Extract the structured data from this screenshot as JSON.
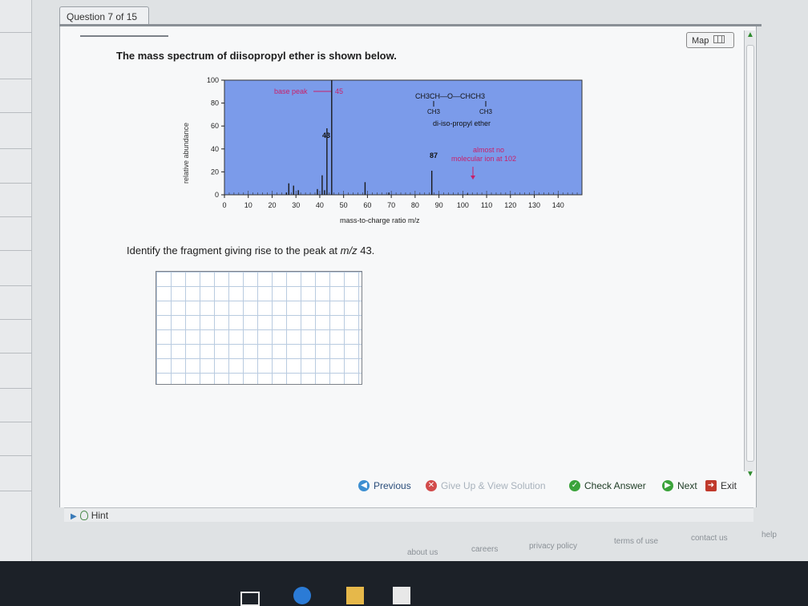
{
  "tab": {
    "title": "Question 7 of 15"
  },
  "map_button": {
    "label": "Map",
    "icon": "grid-icon"
  },
  "question": {
    "text": "The mass spectrum of diisopropyl ether is shown below."
  },
  "chart_data": {
    "type": "bar",
    "xlabel": "mass-to-charge ratio m/z",
    "ylabel": "relative abundance",
    "xlim": [
      0,
      150
    ],
    "ylim": [
      0,
      100
    ],
    "xticks": [
      0,
      10,
      20,
      30,
      40,
      50,
      60,
      70,
      80,
      90,
      100,
      110,
      120,
      130,
      140
    ],
    "yticks": [
      0,
      20,
      40,
      60,
      80,
      100
    ],
    "peaks": [
      {
        "mz": 26,
        "value": 2
      },
      {
        "mz": 27,
        "value": 10
      },
      {
        "mz": 29,
        "value": 8
      },
      {
        "mz": 31,
        "value": 4
      },
      {
        "mz": 39,
        "value": 5
      },
      {
        "mz": 41,
        "value": 17
      },
      {
        "mz": 42,
        "value": 4
      },
      {
        "mz": 43,
        "value": 58
      },
      {
        "mz": 45,
        "value": 100
      },
      {
        "mz": 59,
        "value": 11
      },
      {
        "mz": 69,
        "value": 2
      },
      {
        "mz": 87,
        "value": 21
      },
      {
        "mz": 102,
        "value": 1
      }
    ],
    "annotations": {
      "base_peak": "base peak",
      "base_peak_mz": "45",
      "peak_43": "43",
      "peak_87": "87",
      "almost_no_line1": "almost no",
      "almost_no_line2": "molecular ion at 102",
      "structure_line1": "CH3CH—O—CHCH3",
      "structure_line2_left": "CH3",
      "structure_line2_right": "CH3",
      "structure_name": "di-iso-propyl ether"
    },
    "background_color": "#7b9bea",
    "bar_color": "#1a1a1a",
    "annotation_color": "#c8206a"
  },
  "identify": {
    "prefix": "Identify the fragment giving rise to the peak at ",
    "mz": "m/z",
    "suffix": " 43."
  },
  "nav": {
    "previous": "Previous",
    "give_up": "Give Up & View Solution",
    "check_answer": "Check Answer",
    "next": "Next",
    "exit": "Exit"
  },
  "hint": {
    "label": "Hint"
  },
  "footer": {
    "about": "about us",
    "careers": "careers",
    "privacy": "privacy policy",
    "terms": "terms of use",
    "contact": "contact us",
    "help": "help"
  }
}
